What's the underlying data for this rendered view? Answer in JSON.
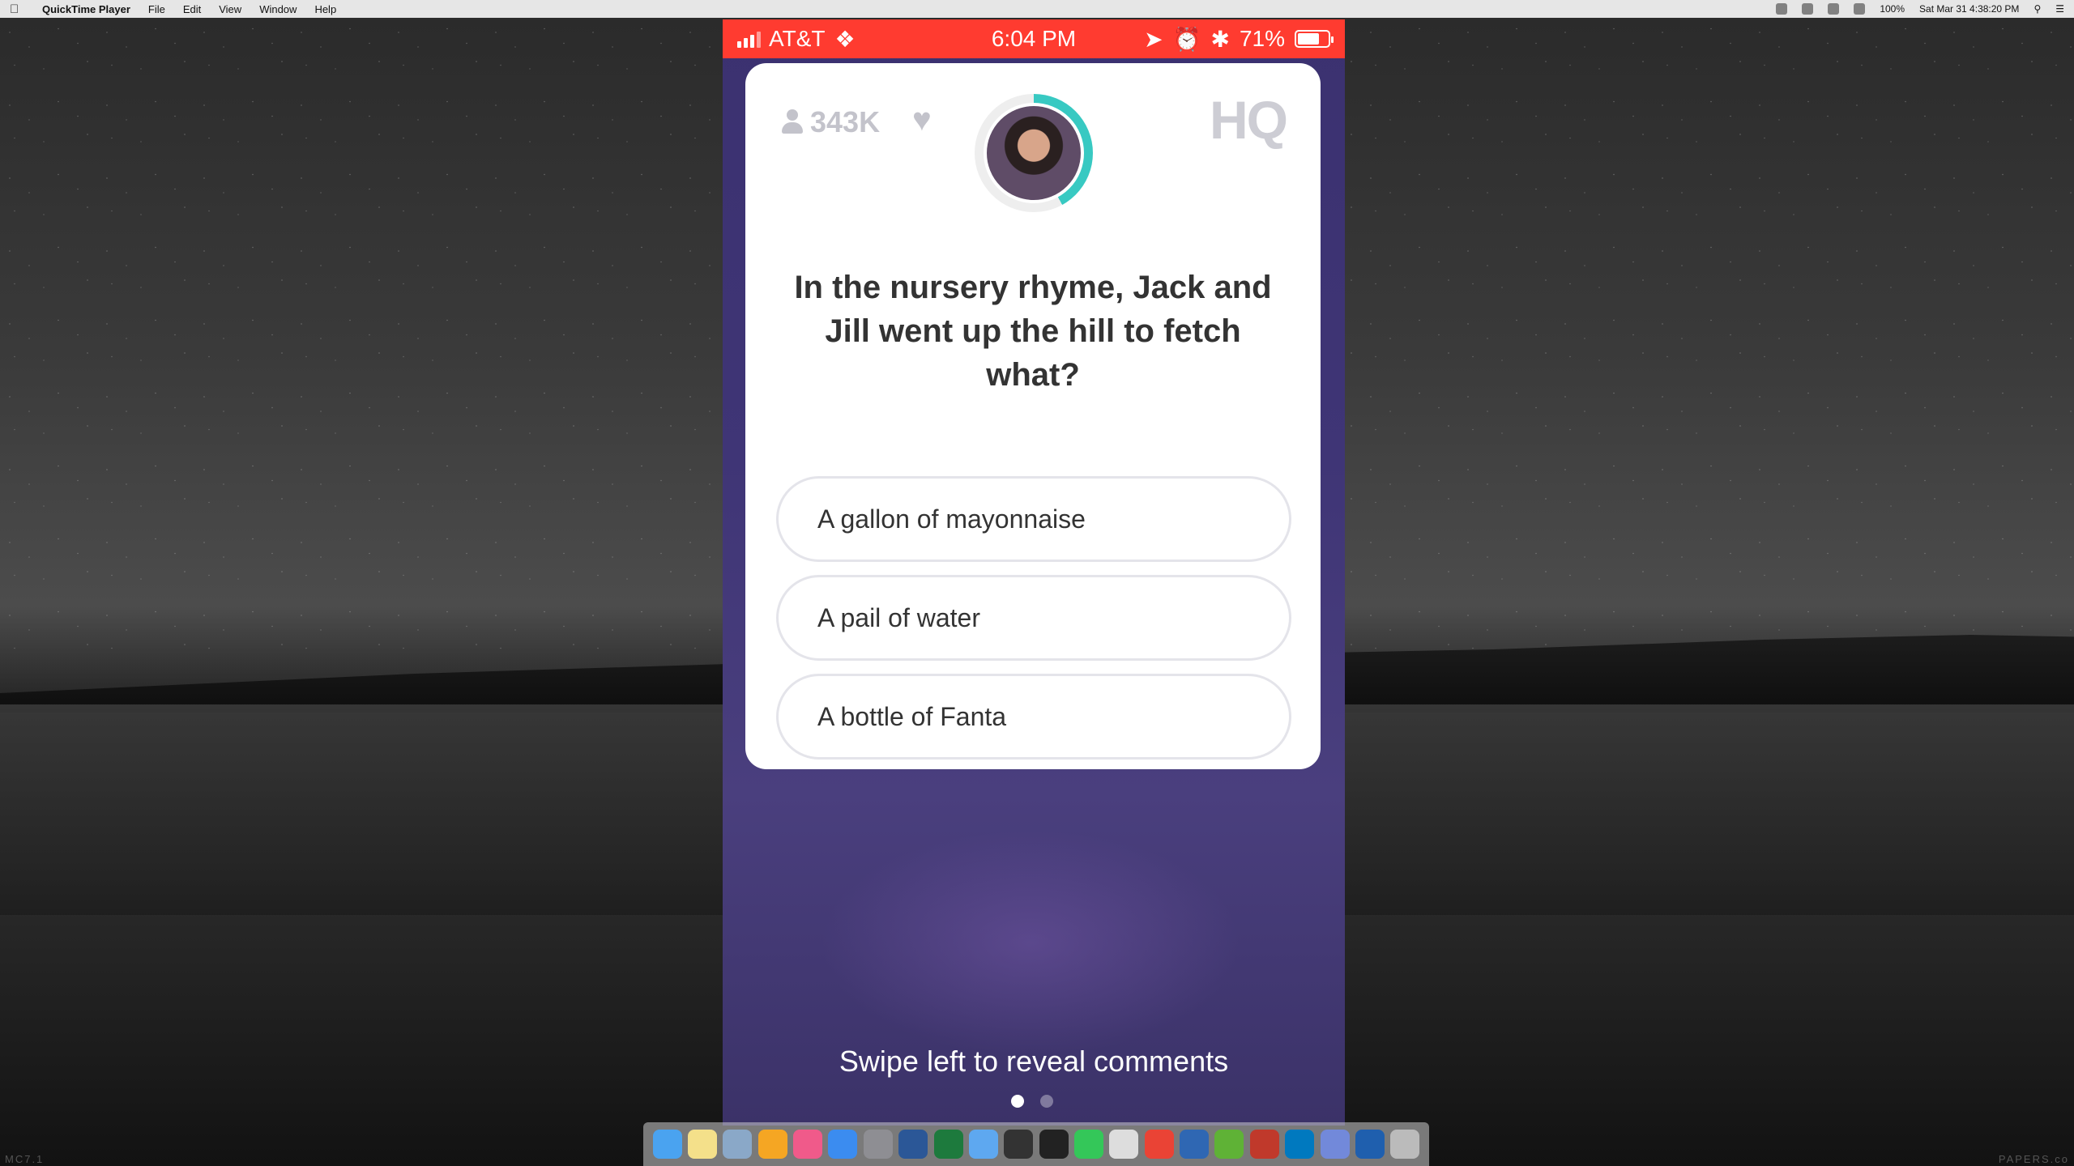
{
  "menubar": {
    "app_name": "QuickTime Player",
    "items": [
      "File",
      "Edit",
      "View",
      "Window",
      "Help"
    ],
    "battery": "100%",
    "datetime": "Sat Mar 31  4:38:20 PM"
  },
  "phone": {
    "status": {
      "carrier": "AT&T",
      "time": "6:04 PM",
      "battery_pct": "71%",
      "battery_level": 0.71,
      "color": "#ff3b30"
    },
    "card": {
      "viewers": "343K",
      "logo": "HQ",
      "timer_color": "#38c9c2",
      "question": "In the nursery rhyme, Jack and Jill went up the hill to fetch what?",
      "answers": [
        "A gallon of mayonnaise",
        "A pail of water",
        "A bottle of Fanta"
      ]
    },
    "swipe_hint": "Swipe left to reveal comments",
    "page_indicator": {
      "count": 2,
      "active": 1
    }
  },
  "dock": {
    "apps": [
      "finder-icon",
      "notes-icon",
      "preview-icon",
      "photos-icon",
      "itunes-icon",
      "app-store-icon",
      "system-preferences-icon",
      "word-icon",
      "excel-icon",
      "xcode-icon",
      "go-icon",
      "terminal-icon",
      "messages-icon",
      "calendar-icon",
      "chrome-icon",
      "virtualbox-icon",
      "evernote-icon",
      "scrivener-icon",
      "trello-icon",
      "discord-icon",
      "quicktime-icon",
      "trash-icon"
    ]
  },
  "watermarks": {
    "left": "MC7.1",
    "right": "PAPERS.co"
  }
}
